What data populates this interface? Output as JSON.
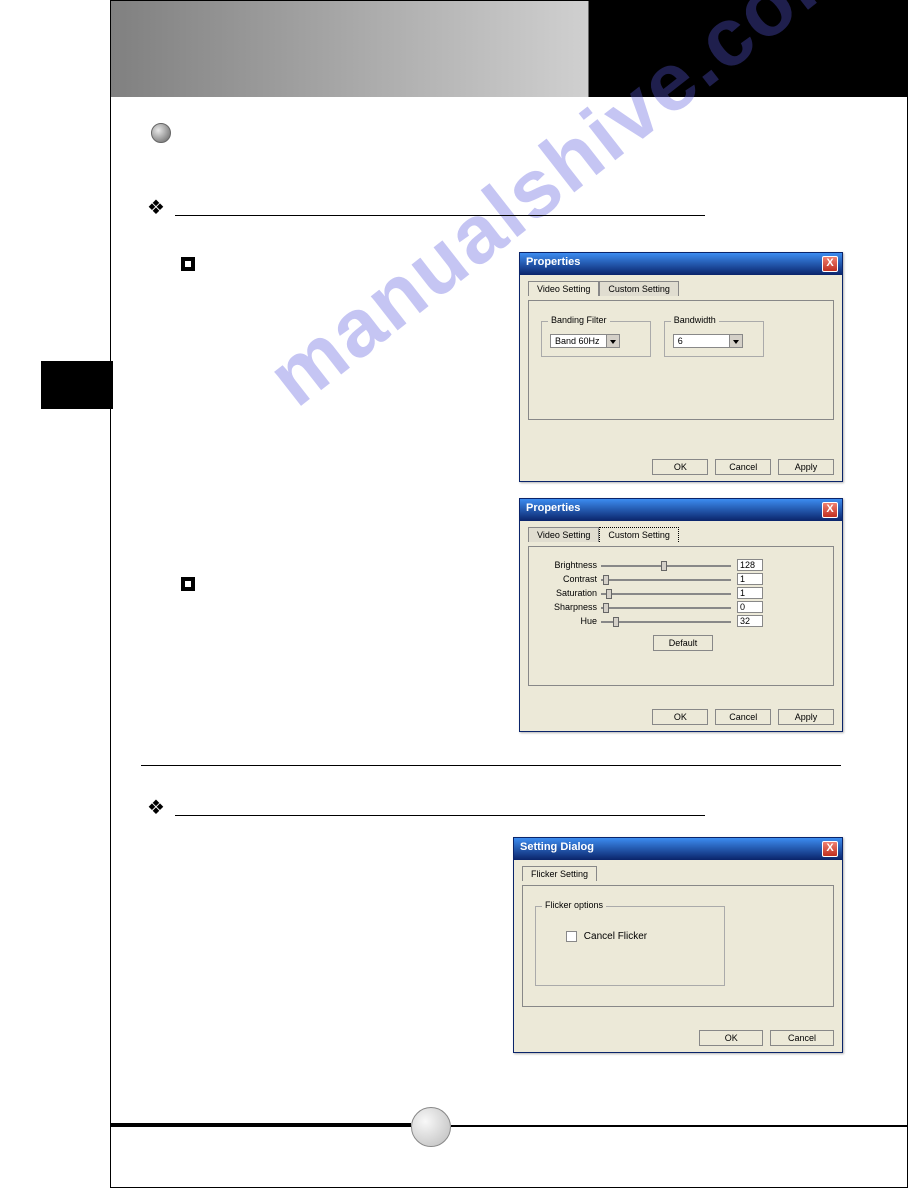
{
  "watermark": "manualshive.com",
  "dialog1": {
    "title": "Properties",
    "close": "X",
    "tab1": "Video Setting",
    "tab2": "Custom Setting",
    "group1_title": "Banding Filter",
    "group1_value": "Band 60Hz",
    "group2_title": "Bandwidth",
    "group2_value": "6",
    "btn_ok": "OK",
    "btn_cancel": "Cancel",
    "btn_apply": "Apply"
  },
  "dialog2": {
    "title": "Properties",
    "close": "X",
    "tab1": "Video Setting",
    "tab2": "Custom Setting",
    "rows": [
      {
        "label": "Brightness",
        "value": "128",
        "pos": 60
      },
      {
        "label": "Contrast",
        "value": "1",
        "pos": 2
      },
      {
        "label": "Saturation",
        "value": "1",
        "pos": 5
      },
      {
        "label": "Sharpness",
        "value": "0",
        "pos": 2
      },
      {
        "label": "Hue",
        "value": "32",
        "pos": 12
      }
    ],
    "btn_default": "Default",
    "btn_ok": "OK",
    "btn_cancel": "Cancel",
    "btn_apply": "Apply"
  },
  "dialog3": {
    "title": "Setting Dialog",
    "close": "X",
    "tab1": "Flicker Setting",
    "group_title": "Flicker options",
    "checkbox_label": "Cancel Flicker",
    "btn_ok": "OK",
    "btn_cancel": "Cancel"
  }
}
